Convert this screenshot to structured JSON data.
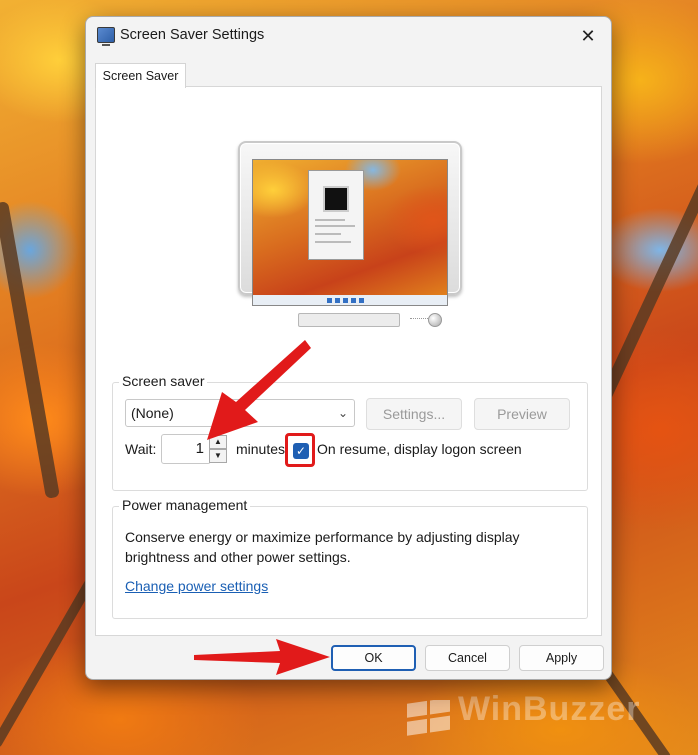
{
  "window": {
    "title": "Screen Saver Settings",
    "close_glyph": "✕"
  },
  "tabs": [
    {
      "label": "Screen Saver",
      "selected": true
    }
  ],
  "screen_saver": {
    "group_label": "Screen saver",
    "selected_value": "(None)",
    "settings_label": "Settings...",
    "preview_label": "Preview",
    "wait_label": "Wait:",
    "wait_value": "1",
    "minutes_label": "minutes",
    "resume_checkbox_label": "On resume, display logon screen",
    "resume_checked": true
  },
  "power_management": {
    "group_label": "Power management",
    "description": "Conserve energy or maximize performance by adjusting display brightness and other power settings.",
    "link_label": "Change power settings"
  },
  "buttons": {
    "ok": "OK",
    "cancel": "Cancel",
    "apply": "Apply"
  },
  "watermark": "WinBuzzer",
  "colors": {
    "accent": "#1f5fb3",
    "annotation": "#e11a1a",
    "link": "#1a5fb4"
  },
  "icons": [
    "monitor-app-icon",
    "close-icon",
    "chevron-down-icon",
    "spin-up-icon",
    "spin-down-icon",
    "checkmark-icon"
  ]
}
